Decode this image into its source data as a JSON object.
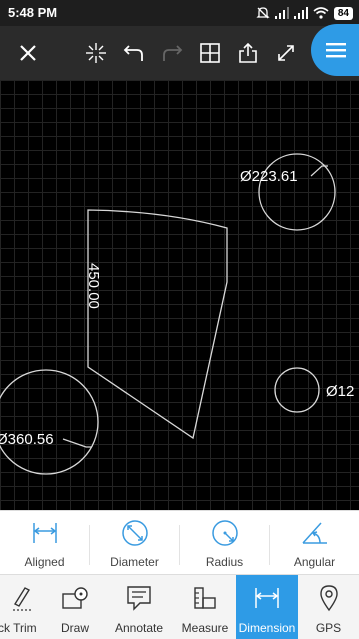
{
  "status_bar": {
    "time": "5:48 PM",
    "battery": "84",
    "icons": [
      "mute-icon",
      "signal-icon",
      "signal-icon",
      "wifi-icon",
      "battery-icon"
    ]
  },
  "toolbar": {
    "buttons": [
      "close-icon",
      "snap-icon",
      "undo-icon",
      "redo-icon",
      "grid-icon",
      "share-icon",
      "fullscreen-icon"
    ],
    "menu": "menu-icon",
    "accent": "#2e9be6"
  },
  "canvas": {
    "dimensions": {
      "circle_top": "Ø223.61",
      "polygon_side": "450.00",
      "circle_left": "Ø360.56",
      "circle_right": "Ø12"
    }
  },
  "dimension_options": [
    {
      "label": "Aligned",
      "icon": "aligned-dimension-icon"
    },
    {
      "label": "Diameter",
      "icon": "diameter-icon"
    },
    {
      "label": "Radius",
      "icon": "radius-icon"
    },
    {
      "label": "Angular",
      "icon": "angular-icon"
    }
  ],
  "tabs": [
    {
      "label": "Quick Trim",
      "icon": "trim-icon"
    },
    {
      "label": "Draw",
      "icon": "draw-icon"
    },
    {
      "label": "Annotate",
      "icon": "annotate-icon"
    },
    {
      "label": "Measure",
      "icon": "measure-icon"
    },
    {
      "label": "Dimension",
      "icon": "dimension-icon",
      "active": true
    },
    {
      "label": "GPS",
      "icon": "gps-icon"
    }
  ]
}
